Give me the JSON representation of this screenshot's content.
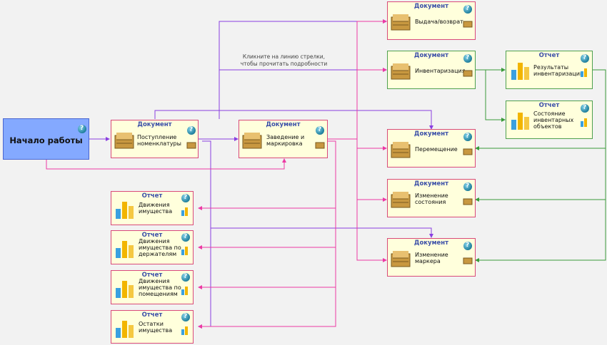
{
  "start": {
    "label": "Начало работы"
  },
  "hint": {
    "line1": "Кликните на линию стрелки,",
    "line2": "чтобы прочитать подробности"
  },
  "kinds": {
    "document": "Документ",
    "report": "Отчет"
  },
  "documents": {
    "receipt": {
      "kind": "Документ",
      "line1": "Поступление",
      "line2": "номенклатуры"
    },
    "registration": {
      "kind": "Документ",
      "line1": "Заведение и",
      "line2": "маркировка"
    },
    "issue": {
      "kind": "Документ",
      "line1": "Выдача/возврат"
    },
    "inventory": {
      "kind": "Документ",
      "line1": "Инвентаризация"
    },
    "transfer": {
      "kind": "Документ",
      "line1": "Перемещение"
    },
    "state_change": {
      "kind": "Документ",
      "line1": "Изменение",
      "line2": "состояния"
    },
    "marker_change": {
      "kind": "Документ",
      "line1": "Изменение",
      "line2": "маркера"
    }
  },
  "reports": {
    "inventory_results": {
      "kind": "Отчет",
      "line1": "Результаты",
      "line2": "инвентаризации"
    },
    "inventory_state": {
      "kind": "Отчет",
      "line1": "Состояние",
      "line2": "инвентарных",
      "line3": "объектов"
    },
    "movements": {
      "kind": "Отчет",
      "line1": "Движения",
      "line2": "имущества"
    },
    "movements_holders": {
      "kind": "Отчет",
      "line1": "Движения",
      "line2": "имущества по",
      "line3": "держателям"
    },
    "movements_rooms": {
      "kind": "Отчет",
      "line1": "Движения",
      "line2": "имущества по",
      "line3": "помещениям"
    },
    "balances": {
      "kind": "Отчет",
      "line1": "Остатки",
      "line2": "имущества"
    }
  },
  "colors": {
    "pink": "#ec3aa4",
    "purple": "#8a3fe0",
    "green": "#3a9a3a",
    "start_fill": "#84a9ff",
    "node_fill": "#ffffdc"
  },
  "icons": {
    "document": "document-stack-icon",
    "report": "bar-chart-icon",
    "help": "help-globe-icon",
    "mini": "mini-box-icon"
  }
}
